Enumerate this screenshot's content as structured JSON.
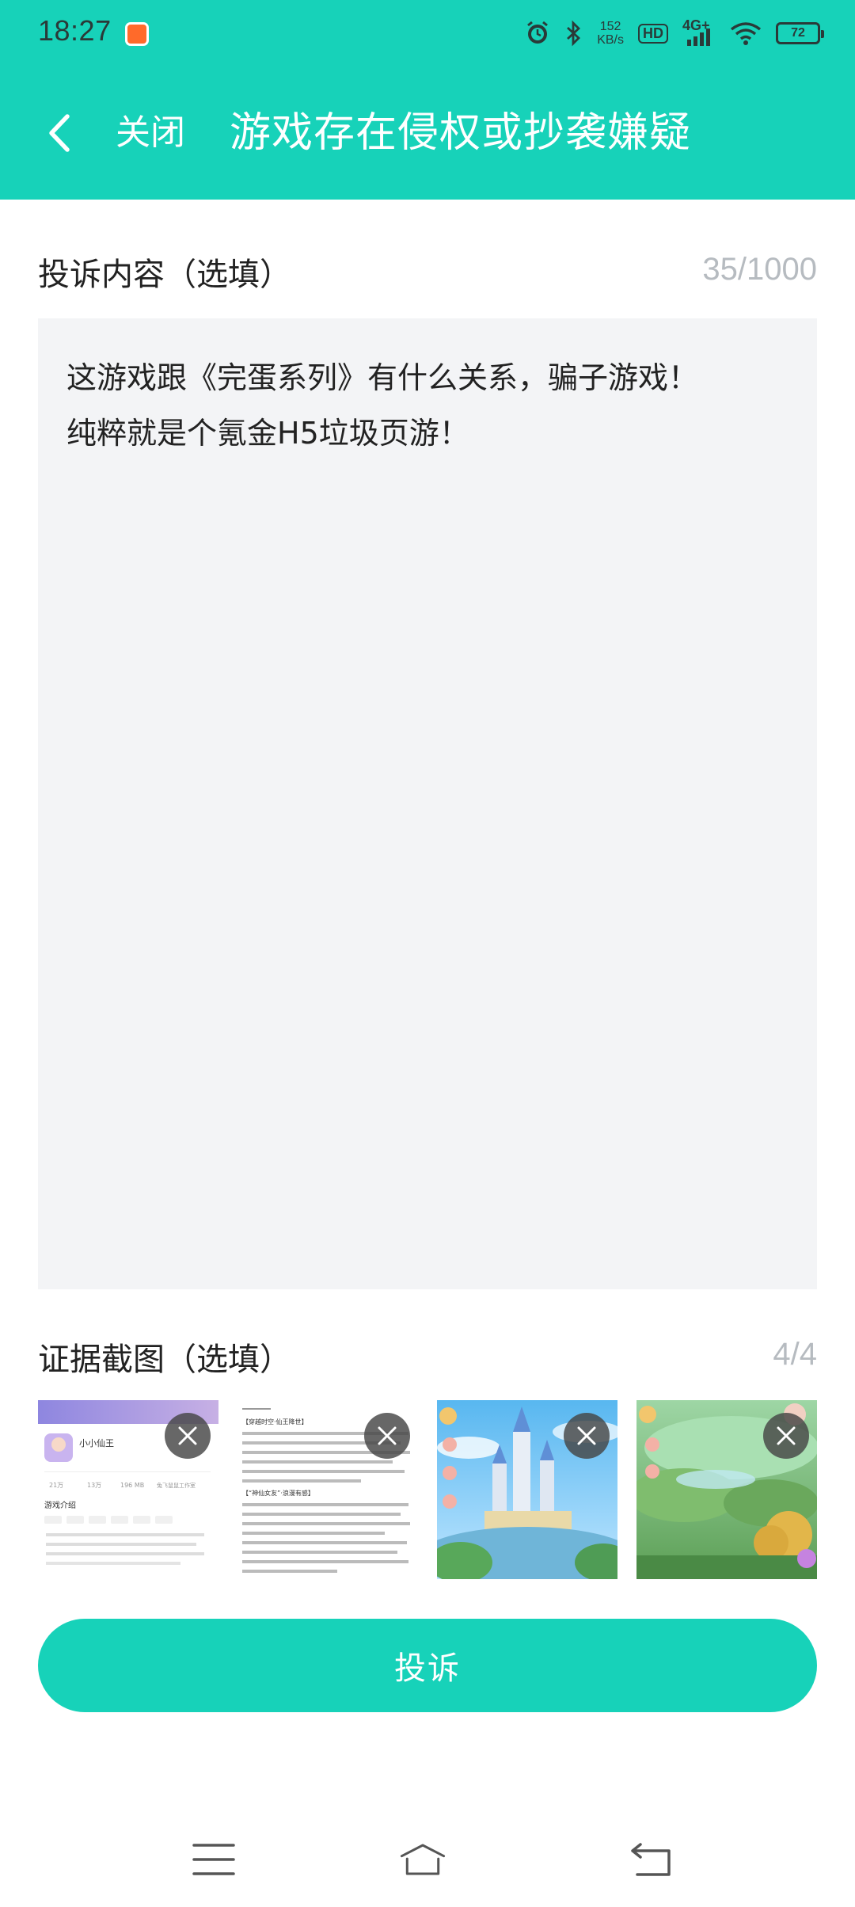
{
  "status_bar": {
    "time": "18:27",
    "net_speed_value": "152",
    "net_speed_unit": "KB/s",
    "hd_label": "HD",
    "network_label": "4G+",
    "battery_level": "72"
  },
  "header": {
    "close_label": "关闭",
    "title": "游戏存在侵权或抄袭嫌疑"
  },
  "complaint": {
    "section_title": "投诉内容（选填）",
    "counter": "35/1000",
    "content": "这游戏跟《完蛋系列》有什么关系，骗子游戏！\n纯粹就是个氪金H5垃圾页游！"
  },
  "evidence": {
    "section_title": "证据截图（选填）",
    "counter": "4/4",
    "screenshots": [
      {
        "name": "screenshot-game-page",
        "game_name": "小小仙王",
        "section": "游戏介绍",
        "stats": [
          "21万",
          "13万",
          "196 MB",
          "兔飞鼠鼠工作室"
        ]
      },
      {
        "name": "screenshot-game-description",
        "heading": "【穿越时空·仙王降世】",
        "sub_heading": "【“神仙女友”·浪漫有感】"
      },
      {
        "name": "screenshot-gameplay-castle"
      },
      {
        "name": "screenshot-gameplay-forest"
      }
    ]
  },
  "submit_label": "投诉",
  "colors": {
    "accent": "#17d2b9",
    "textarea_bg": "#f3f4f6",
    "counter_gray": "#b6bbc0"
  },
  "icons": {
    "back": "chevron-left-icon",
    "remove": "close-icon",
    "nav_menu": "menu-icon",
    "nav_home": "home-icon",
    "nav_back": "back-arrow-icon"
  }
}
